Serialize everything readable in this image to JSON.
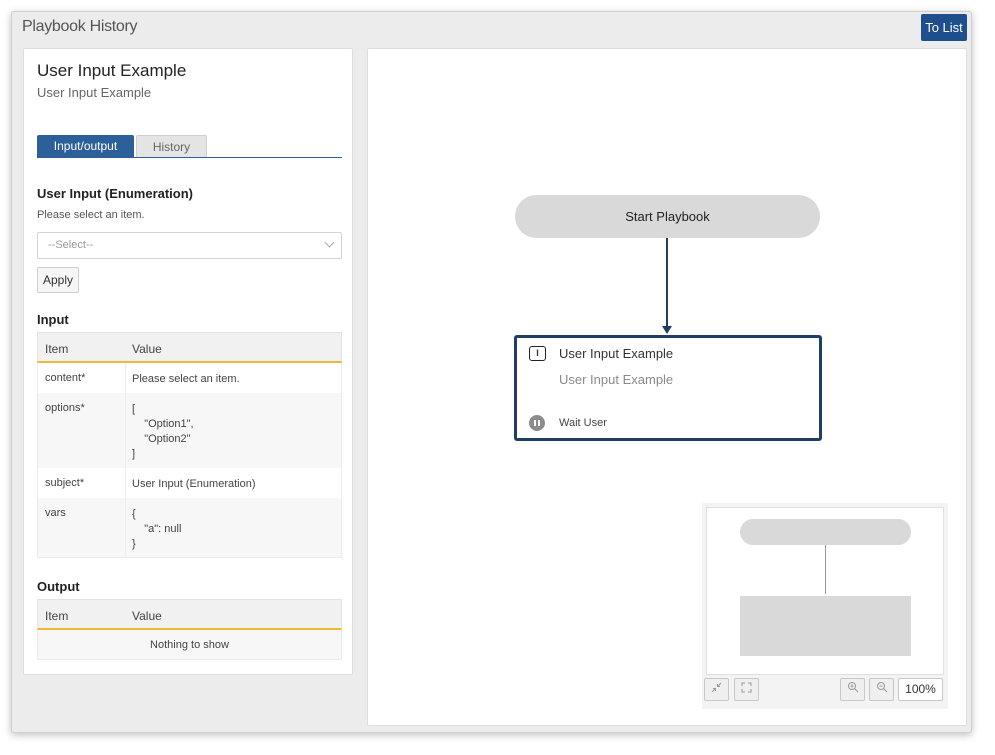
{
  "window": {
    "title": "Playbook History",
    "to_list_label": "To List"
  },
  "playbook": {
    "title": "User Input Example",
    "subtitle": "User Input Example"
  },
  "tabs": [
    {
      "label": "Input/output",
      "active": true
    },
    {
      "label": "History",
      "active": false
    }
  ],
  "user_input": {
    "heading": "User Input (Enumeration)",
    "hint": "Please select an item.",
    "select_placeholder": "--Select--",
    "apply_label": "Apply"
  },
  "input_table": {
    "heading": "Input",
    "columns": [
      "Item",
      "Value"
    ],
    "rows": [
      {
        "item": "content*",
        "value": "Please select an item."
      },
      {
        "item": "options*",
        "value": "[\n    \"Option1\",\n    \"Option2\"\n]"
      },
      {
        "item": "subject*",
        "value": "User Input (Enumeration)"
      },
      {
        "item": "vars",
        "value": "{\n    \"a\": null\n}"
      }
    ]
  },
  "output_table": {
    "heading": "Output",
    "columns": [
      "Item",
      "Value"
    ],
    "empty_text": "Nothing to show"
  },
  "flow": {
    "start_label": "Start Playbook",
    "task": {
      "title": "User Input Example",
      "subtitle": "User Input Example",
      "status": "Wait User",
      "icon": "text-input-icon"
    }
  },
  "minimap_controls": {
    "collapse_icon": "collapse-icon",
    "fullscreen_icon": "fullscreen-icon",
    "zoom_in_icon": "zoom-in-icon",
    "zoom_out_icon": "zoom-out-icon",
    "zoom_level": "100%"
  },
  "colors": {
    "accent": "#1f4e8c",
    "node_border": "#1f3e63",
    "table_header_rule": "#f0b932"
  }
}
